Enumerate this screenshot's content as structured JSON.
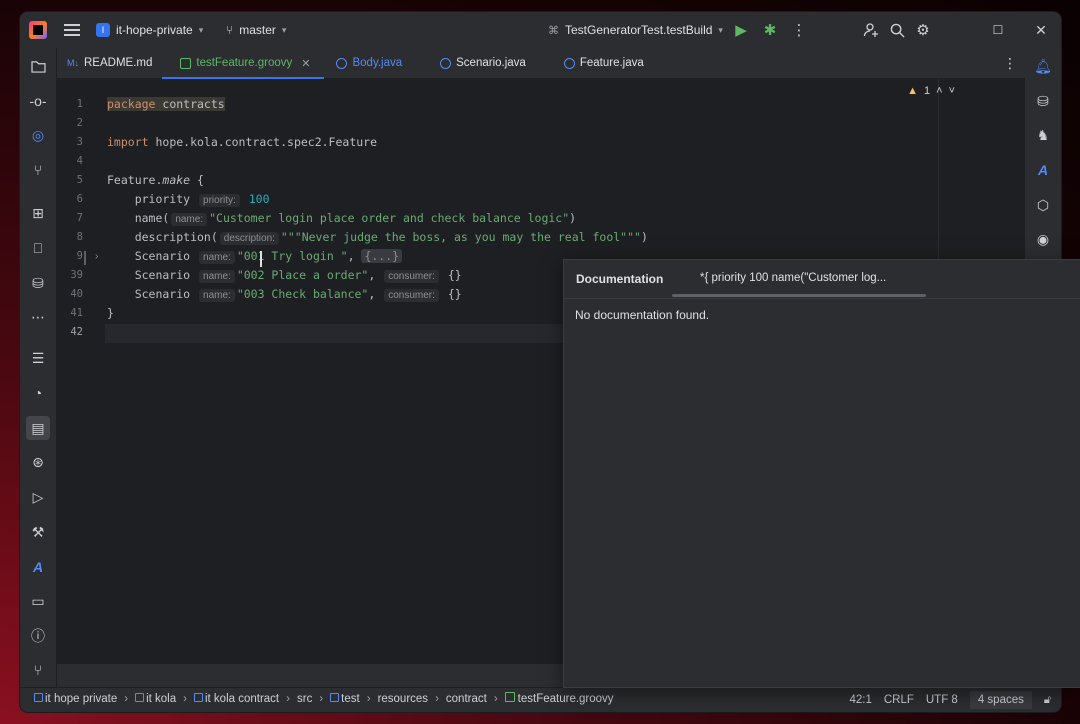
{
  "titlebar": {
    "project_badge": "I",
    "project_name": "it-hope-private",
    "branch": "master",
    "run_config": "TestGeneratorTest.testBuild"
  },
  "tabs": [
    {
      "label": "README.md",
      "icon": "markdown-icon",
      "prefix": "M↓"
    },
    {
      "label": "testFeature.groovy",
      "icon": "groovy-file-icon",
      "active": true
    },
    {
      "label": "Body.java",
      "icon": "class-icon",
      "prefix": "C"
    },
    {
      "label": "Scenario.java",
      "icon": "class-icon",
      "prefix": "C"
    },
    {
      "label": "Feature.java",
      "icon": "class-icon",
      "prefix": "C"
    }
  ],
  "editor": {
    "line_numbers": [
      "1",
      "2",
      "3",
      "4",
      "5",
      "6",
      "7",
      "8",
      "9",
      "39",
      "40",
      "41",
      "42"
    ],
    "code": {
      "l1_kw": "package",
      "l1_rest": " contracts",
      "l3_kw": "import",
      "l3_rest": " hope.kola.contract.spec2.Feature",
      "l5_a": "Feature.",
      "l5_fn": "make",
      "l5_b": " {",
      "l6_a": "    priority ",
      "l6_hint": "priority:",
      "l6_num": " 100",
      "l7_a": "    name(",
      "l7_hint": "name:",
      "l7_str": "\"Customer login place order and check balance logic\"",
      "l7_b": ")",
      "l8_a": "    description(",
      "l8_hint": "description:",
      "l8_str": "\"\"\"Never judge the boss, as you may the real fool\"\"\"",
      "l8_b": ")",
      "l9_a": "    Scenario ",
      "l9_hint": "name:",
      "l9_str": "\"001 Try login \"",
      "l9_b": ", ",
      "l9_fold": "{...}",
      "l39_a": "    Scenario ",
      "l39_hint": "name:",
      "l39_str": "\"002 Place a order\"",
      "l39_b": ", ",
      "l39_hint2": "consumer:",
      "l39_c": " {}",
      "l40_a": "    Scenario ",
      "l40_hint": "name:",
      "l40_str": "\"003 Check balance\"",
      "l40_b": ", ",
      "l40_hint2": "consumer:",
      "l40_c": " {}",
      "l41": "}"
    },
    "inspection_count": "1"
  },
  "documentation": {
    "title": "Documentation",
    "crumb": "*{   priority 100   name(\"Customer log...",
    "body": "No documentation found."
  },
  "statusbar": {
    "breadcrumb": [
      "it hope private",
      "it kola",
      "it kola contract",
      "src",
      "test",
      "resources",
      "contract",
      "testFeature.groovy"
    ],
    "position": "42:1",
    "line_sep": "CRLF",
    "encoding": "UTF 8",
    "indent": "4 spaces"
  },
  "colors": {
    "accent": "#3574f0",
    "keyword": "#cf8e6d",
    "string": "#6aab73",
    "number": "#2aacb8",
    "warning": "#f2c55c"
  }
}
